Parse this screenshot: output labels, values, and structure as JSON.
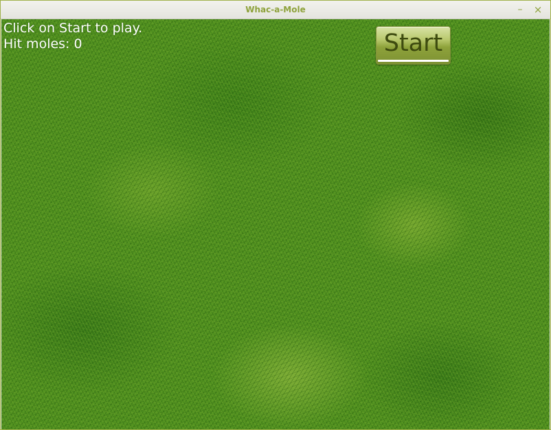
{
  "window": {
    "title": "Whac-a-Mole",
    "minimize_glyph": "–",
    "close_glyph": "×"
  },
  "hud": {
    "status": "Click on Start to play.",
    "hits": "Hit moles: 0"
  },
  "start_button": {
    "label": "Start"
  },
  "colors": {
    "title_accent": "#8ea23b",
    "grass_base": "#4f8f1f",
    "button_top": "#d9e3a6",
    "button_bottom": "#7d9132",
    "hud_text": "#ffffff"
  },
  "icons": {
    "minimize": "minimize-icon",
    "close": "close-icon"
  }
}
